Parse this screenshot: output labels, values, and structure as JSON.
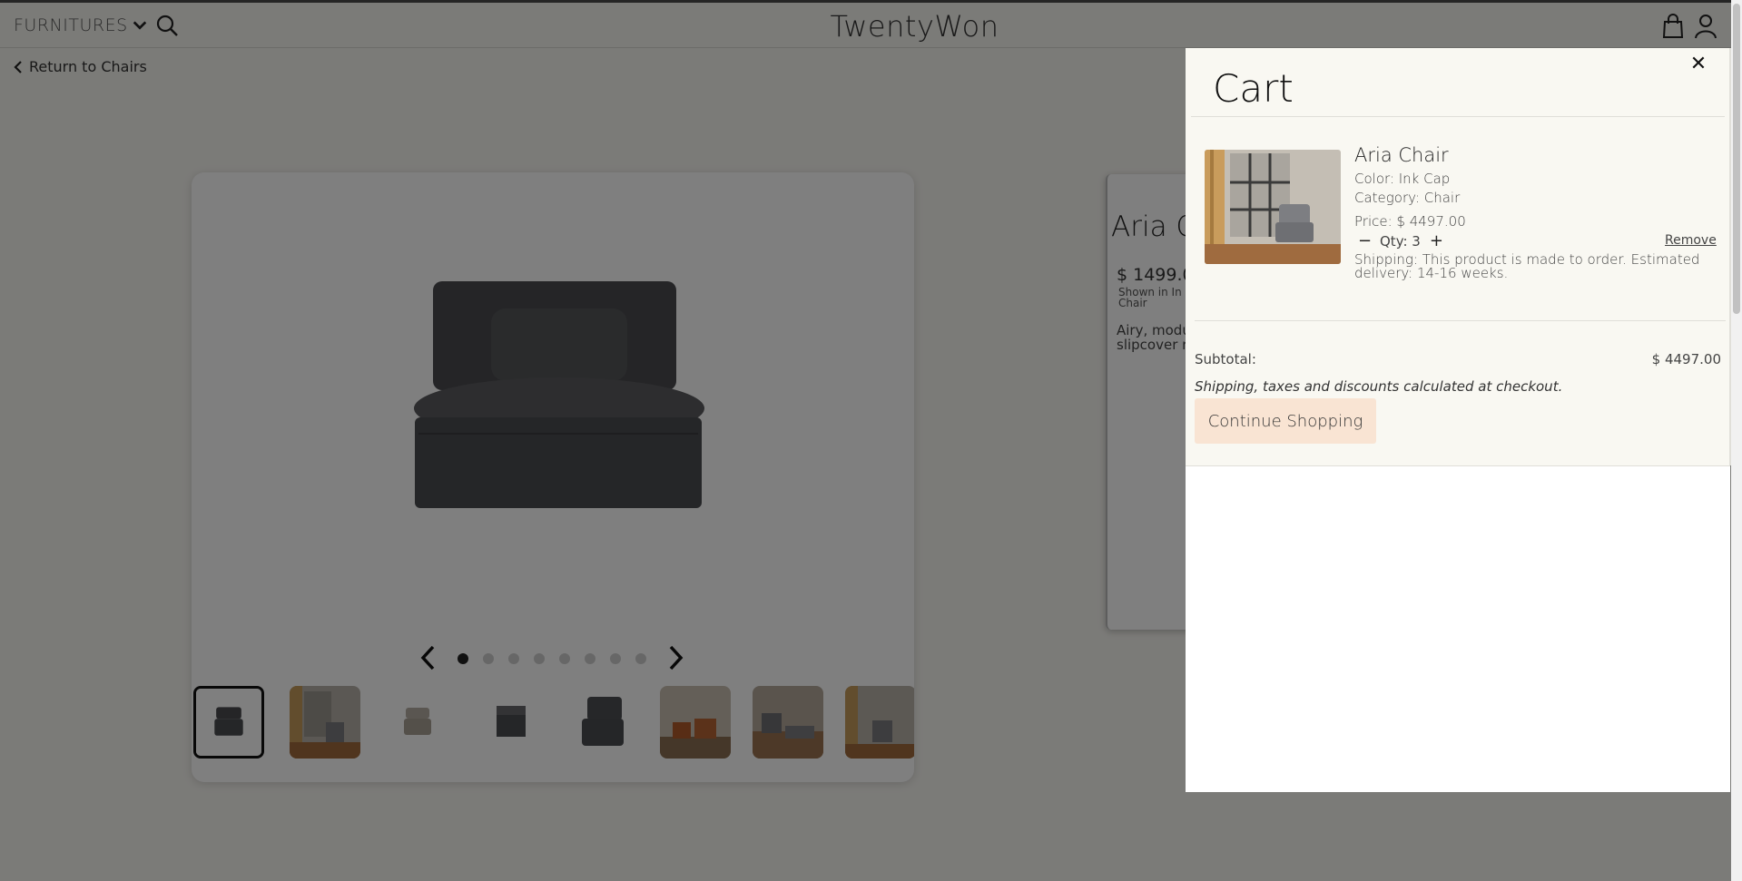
{
  "header": {
    "menu_label": "FURNITURES",
    "brand": "TwentyWon"
  },
  "nav": {
    "back_label": "Return to Chairs"
  },
  "gallery": {
    "dot_count": 8,
    "active_dot": 1,
    "thumbnail_count": 8,
    "selected_thumbnail": 1
  },
  "product": {
    "title": "Aria C",
    "price": "$ 1499.0",
    "shown_in": "Shown in In Chair",
    "description": "Airy, modu slipcover r"
  },
  "cart": {
    "title": "Cart",
    "close_icon": "close-icon",
    "item": {
      "name": "Aria Chair",
      "color": "Color: Ink Cap",
      "category": "Category: Chair",
      "price": "Price: $ 4497.00",
      "qty_label": "Qty: 3",
      "decrement": "−",
      "increment": "+",
      "remove_label": "Remove",
      "shipping": "Shipping: This product is made to order. Estimated delivery: 14-16 weeks."
    },
    "subtotal_label": "Subtotal:",
    "subtotal_value": "$ 4497.00",
    "checkout_note": "Shipping, taxes and discounts calculated at checkout.",
    "continue_label": "Continue Shopping"
  },
  "colors": {
    "accent_button": "#f9e4d3",
    "drawer_bg": "#f9f8f2",
    "overlay": "rgba(0,0,0,0.5)"
  }
}
